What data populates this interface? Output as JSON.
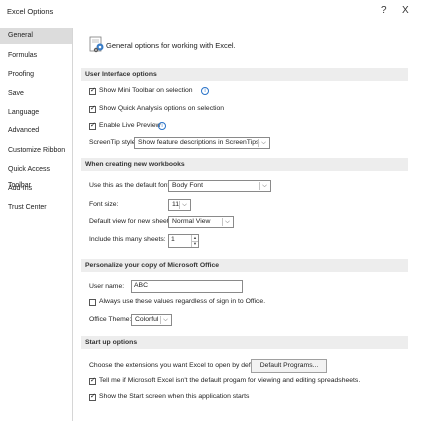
{
  "window": {
    "title": "Excel Options",
    "help_label": "?",
    "close_label": "X"
  },
  "sidebar": {
    "items": [
      {
        "label": "General"
      },
      {
        "label": "Formulas"
      },
      {
        "label": "Proofing"
      },
      {
        "label": "Save"
      },
      {
        "label": "Language"
      },
      {
        "label": "Advanced"
      },
      {
        "label": "Customize Ribbon"
      },
      {
        "label": "Quick Access Toolbar"
      },
      {
        "label": "Add-Ins"
      },
      {
        "label": "Trust Center"
      }
    ]
  },
  "header": {
    "text": "General options for working with Excel."
  },
  "ui_options": {
    "heading": "User Interface options",
    "mini_toolbar": "Show Mini Toolbar on selection",
    "quick_analysis": "Show Quick Analysis options on selection",
    "live_preview": "Enable Live Preview",
    "screentip_label": "ScreenTip style:",
    "screentip_value": "Show feature descriptions in ScreenTips"
  },
  "new_workbooks": {
    "heading": "When creating new workbooks",
    "font_label": "Use this as the default font:",
    "font_value": "Body Font",
    "size_label": "Font size:",
    "size_value": "11",
    "view_label": "Default view for new sheets:",
    "view_value": "Normal View",
    "sheets_label": "Include this many sheets:",
    "sheets_value": "1"
  },
  "personalize": {
    "heading": "Personalize your copy of Microsoft Office",
    "username_label": "User name:",
    "username_value": "ABC",
    "always_use": "Always use these values regardless of sign in to Office.",
    "theme_label": "Office Theme:",
    "theme_value": "Colorful"
  },
  "startup": {
    "heading": "Start up options",
    "extensions_label": "Choose the extensions you want Excel to open by default:",
    "default_programs": "Default Programs...",
    "tell_me": "Tell me if Microsoft Excel isn't the default progam for viewing and editing spreadsheets.",
    "show_start": "Show the Start screen when this application starts"
  },
  "icons": {
    "info": "i",
    "dropdown": "⌵",
    "spin_up": "▲",
    "spin_down": "▼"
  },
  "colors": {
    "info_blue": "#2a73c8",
    "section_bg": "#ededed",
    "sidebar_active": "#dcdcdc"
  }
}
